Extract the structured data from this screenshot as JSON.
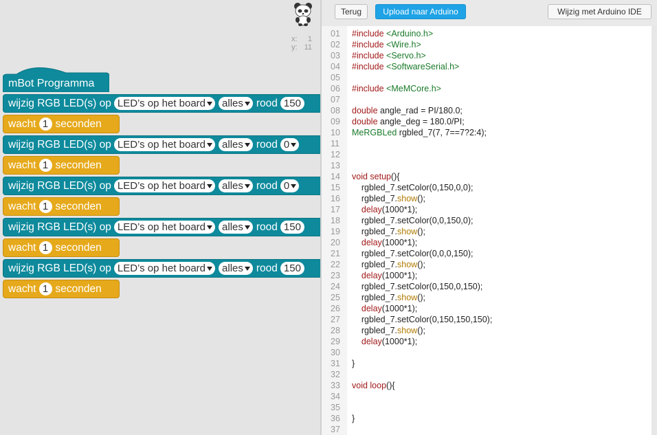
{
  "sprite": {
    "icon": "panda-icon"
  },
  "coords": {
    "x_label": "x:",
    "x_value": "1",
    "y_label": "y:",
    "y_value": "11"
  },
  "hat": {
    "label": "mBot Programma"
  },
  "blocks": [
    {
      "kind": "led",
      "text1": "wijzig RGB LED(s) op",
      "target": "LED’s op het board",
      "which": "alles",
      "color_label": "rood",
      "value": "150"
    },
    {
      "kind": "wait",
      "text1": "wacht",
      "value": "1",
      "text2": "seconden"
    },
    {
      "kind": "led",
      "text1": "wijzig RGB LED(s) op",
      "target": "LED’s op het board",
      "which": "alles",
      "color_label": "rood",
      "value": "0"
    },
    {
      "kind": "wait",
      "text1": "wacht",
      "value": "1",
      "text2": "seconden"
    },
    {
      "kind": "led",
      "text1": "wijzig RGB LED(s) op",
      "target": "LED’s op het board",
      "which": "alles",
      "color_label": "rood",
      "value": "0"
    },
    {
      "kind": "wait",
      "text1": "wacht",
      "value": "1",
      "text2": "seconden"
    },
    {
      "kind": "led",
      "text1": "wijzig RGB LED(s) op",
      "target": "LED’s op het board",
      "which": "alles",
      "color_label": "rood",
      "value": "150"
    },
    {
      "kind": "wait",
      "text1": "wacht",
      "value": "1",
      "text2": "seconden"
    },
    {
      "kind": "led",
      "text1": "wijzig RGB LED(s) op",
      "target": "LED’s op het board",
      "which": "alles",
      "color_label": "rood",
      "value": "150"
    },
    {
      "kind": "wait",
      "text1": "wacht",
      "value": "1",
      "text2": "seconden"
    }
  ],
  "toolbar": {
    "back_label": "Terug",
    "upload_label": "Upload naar Arduino",
    "edit_label": "Wijzig met Arduino IDE"
  },
  "colors": {
    "led_block": "#0e8a9c",
    "wait_block": "#e6a91b",
    "primary_button": "#1fa3e6"
  },
  "code_lines": [
    {
      "n": "01",
      "parts": [
        [
          "kw",
          "#include "
        ],
        [
          "str",
          "<Arduino.h>"
        ]
      ]
    },
    {
      "n": "02",
      "parts": [
        [
          "kw",
          "#include "
        ],
        [
          "str",
          "<Wire.h>"
        ]
      ]
    },
    {
      "n": "03",
      "parts": [
        [
          "kw",
          "#include "
        ],
        [
          "str",
          "<Servo.h>"
        ]
      ]
    },
    {
      "n": "04",
      "parts": [
        [
          "kw",
          "#include "
        ],
        [
          "str",
          "<SoftwareSerial.h>"
        ]
      ]
    },
    {
      "n": "05",
      "parts": []
    },
    {
      "n": "06",
      "parts": [
        [
          "kw",
          "#include "
        ],
        [
          "str",
          "<MeMCore.h>"
        ]
      ]
    },
    {
      "n": "07",
      "parts": []
    },
    {
      "n": "08",
      "parts": [
        [
          "kw",
          "double "
        ],
        [
          "",
          "angle_rad = PI/180.0;"
        ]
      ]
    },
    {
      "n": "09",
      "parts": [
        [
          "kw",
          "double "
        ],
        [
          "",
          "angle_deg = 180.0/PI;"
        ]
      ]
    },
    {
      "n": "10",
      "parts": [
        [
          "str",
          "MeRGBLed "
        ],
        [
          "",
          "rgbled_7(7, 7==7?2:4);"
        ]
      ]
    },
    {
      "n": "11",
      "parts": []
    },
    {
      "n": "12",
      "parts": []
    },
    {
      "n": "13",
      "parts": []
    },
    {
      "n": "14",
      "parts": [
        [
          "kw",
          "void "
        ],
        [
          "fn",
          "setup"
        ],
        [
          "",
          "(){"
        ]
      ]
    },
    {
      "n": "15",
      "parts": [
        [
          "",
          "    rgbled_7.setColor(0,150,0,0);"
        ]
      ]
    },
    {
      "n": "16",
      "parts": [
        [
          "",
          "    rgbled_7."
        ],
        [
          "mth",
          "show"
        ],
        [
          "",
          "();"
        ]
      ]
    },
    {
      "n": "17",
      "parts": [
        [
          "",
          "    "
        ],
        [
          "fn",
          "delay"
        ],
        [
          "",
          "(1000*1);"
        ]
      ]
    },
    {
      "n": "18",
      "parts": [
        [
          "",
          "    rgbled_7.setColor(0,0,150,0);"
        ]
      ]
    },
    {
      "n": "19",
      "parts": [
        [
          "",
          "    rgbled_7."
        ],
        [
          "mth",
          "show"
        ],
        [
          "",
          "();"
        ]
      ]
    },
    {
      "n": "20",
      "parts": [
        [
          "",
          "    "
        ],
        [
          "fn",
          "delay"
        ],
        [
          "",
          "(1000*1);"
        ]
      ]
    },
    {
      "n": "21",
      "parts": [
        [
          "",
          "    rgbled_7.setColor(0,0,0,150);"
        ]
      ]
    },
    {
      "n": "22",
      "parts": [
        [
          "",
          "    rgbled_7."
        ],
        [
          "mth",
          "show"
        ],
        [
          "",
          "();"
        ]
      ]
    },
    {
      "n": "23",
      "parts": [
        [
          "",
          "    "
        ],
        [
          "fn",
          "delay"
        ],
        [
          "",
          "(1000*1);"
        ]
      ]
    },
    {
      "n": "24",
      "parts": [
        [
          "",
          "    rgbled_7.setColor(0,150,0,150);"
        ]
      ]
    },
    {
      "n": "25",
      "parts": [
        [
          "",
          "    rgbled_7."
        ],
        [
          "mth",
          "show"
        ],
        [
          "",
          "();"
        ]
      ]
    },
    {
      "n": "26",
      "parts": [
        [
          "",
          "    "
        ],
        [
          "fn",
          "delay"
        ],
        [
          "",
          "(1000*1);"
        ]
      ]
    },
    {
      "n": "27",
      "parts": [
        [
          "",
          "    rgbled_7.setColor(0,150,150,150);"
        ]
      ]
    },
    {
      "n": "28",
      "parts": [
        [
          "",
          "    rgbled_7."
        ],
        [
          "mth",
          "show"
        ],
        [
          "",
          "();"
        ]
      ]
    },
    {
      "n": "29",
      "parts": [
        [
          "",
          "    "
        ],
        [
          "fn",
          "delay"
        ],
        [
          "",
          "(1000*1);"
        ]
      ]
    },
    {
      "n": "30",
      "parts": []
    },
    {
      "n": "31",
      "parts": [
        [
          "",
          "}"
        ]
      ]
    },
    {
      "n": "32",
      "parts": []
    },
    {
      "n": "33",
      "parts": [
        [
          "kw",
          "void "
        ],
        [
          "fn",
          "loop"
        ],
        [
          "",
          "(){"
        ]
      ]
    },
    {
      "n": "34",
      "parts": []
    },
    {
      "n": "35",
      "parts": []
    },
    {
      "n": "36",
      "parts": [
        [
          "",
          "}"
        ]
      ]
    },
    {
      "n": "37",
      "parts": []
    }
  ]
}
